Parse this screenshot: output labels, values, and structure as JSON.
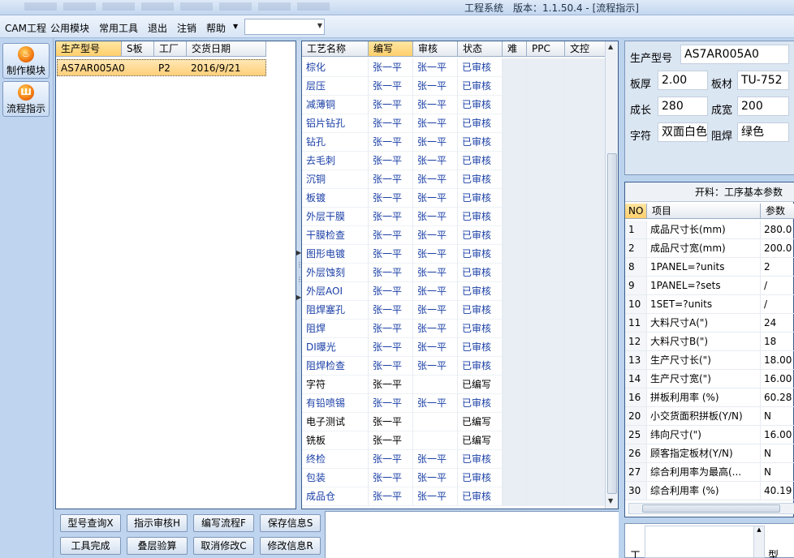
{
  "window": {
    "title": "工程系统　版本：1.1.50.4 - [流程指示]"
  },
  "menu": {
    "items": [
      "CAM工程",
      "公用模块",
      "常用工具",
      "退出",
      "注销",
      "帮助"
    ],
    "combo_value": ""
  },
  "nav": {
    "make_label": "制作模块",
    "flow_label": "流程指示"
  },
  "orders": {
    "headers": [
      "生产型号",
      "S板",
      "工厂",
      "交货日期"
    ],
    "rows": [
      {
        "model": "AS7AR005A0",
        "s": "",
        "factory": "P2",
        "date": "2016/9/21"
      }
    ]
  },
  "process": {
    "headers": [
      "工艺名称",
      "编写",
      "审核",
      "状态",
      "难",
      "PPC",
      "文控"
    ],
    "rows": [
      {
        "name": "棕化",
        "writer": "张一平",
        "reviewer": "张一平",
        "status": "已审核"
      },
      {
        "name": "层压",
        "writer": "张一平",
        "reviewer": "张一平",
        "status": "已审核"
      },
      {
        "name": "减薄铜",
        "writer": "张一平",
        "reviewer": "张一平",
        "status": "已审核"
      },
      {
        "name": "铝片钻孔",
        "writer": "张一平",
        "reviewer": "张一平",
        "status": "已审核"
      },
      {
        "name": "钻孔",
        "writer": "张一平",
        "reviewer": "张一平",
        "status": "已审核"
      },
      {
        "name": "去毛刺",
        "writer": "张一平",
        "reviewer": "张一平",
        "status": "已审核"
      },
      {
        "name": "沉铜",
        "writer": "张一平",
        "reviewer": "张一平",
        "status": "已审核"
      },
      {
        "name": "板镀",
        "writer": "张一平",
        "reviewer": "张一平",
        "status": "已审核"
      },
      {
        "name": "外层干膜",
        "writer": "张一平",
        "reviewer": "张一平",
        "status": "已审核"
      },
      {
        "name": "干膜检查",
        "writer": "张一平",
        "reviewer": "张一平",
        "status": "已审核"
      },
      {
        "name": "图形电镀",
        "writer": "张一平",
        "reviewer": "张一平",
        "status": "已审核"
      },
      {
        "name": "外层蚀刻",
        "writer": "张一平",
        "reviewer": "张一平",
        "status": "已审核"
      },
      {
        "name": "外层AOI",
        "writer": "张一平",
        "reviewer": "张一平",
        "status": "已审核"
      },
      {
        "name": "阻焊塞孔",
        "writer": "张一平",
        "reviewer": "张一平",
        "status": "已审核"
      },
      {
        "name": "阻焊",
        "writer": "张一平",
        "reviewer": "张一平",
        "status": "已审核"
      },
      {
        "name": "DI曝光",
        "writer": "张一平",
        "reviewer": "张一平",
        "status": "已审核"
      },
      {
        "name": "阻焊检查",
        "writer": "张一平",
        "reviewer": "张一平",
        "status": "已审核"
      },
      {
        "name": "字符",
        "writer": "张一平",
        "reviewer": "",
        "status": "已编写"
      },
      {
        "name": "有铅喷锡",
        "writer": "张一平",
        "reviewer": "张一平",
        "status": "已审核"
      },
      {
        "name": "电子测试",
        "writer": "张一平",
        "reviewer": "",
        "status": "已编写"
      },
      {
        "name": "铣板",
        "writer": "张一平",
        "reviewer": "",
        "status": "已编写"
      },
      {
        "name": "终检",
        "writer": "张一平",
        "reviewer": "张一平",
        "status": "已审核"
      },
      {
        "name": "包装",
        "writer": "张一平",
        "reviewer": "张一平",
        "status": "已审核"
      },
      {
        "name": "成品仓",
        "writer": "张一平",
        "reviewer": "张一平",
        "status": "已审核"
      }
    ]
  },
  "buttons": {
    "row1": [
      "型号查询X",
      "指示审核H",
      "编写流程F",
      "保存信息S"
    ],
    "row2": [
      "工具完成",
      "叠层验算",
      "取消修改C",
      "修改信息R"
    ]
  },
  "info": {
    "model_label": "生产型号",
    "model_value": "AS7AR005A0",
    "thickness_label": "板厚",
    "thickness_value": "2.00",
    "material_label": "板材",
    "material_value": "TU-752",
    "length_label": "成长",
    "length_value": "280",
    "width_label": "成宽",
    "width_value": "200",
    "char_label": "字符",
    "char_value": "双面白色",
    "mask_label": "阻焊",
    "mask_value": "绿色"
  },
  "params": {
    "caption": "开料：工序基本参数",
    "headers": [
      "NO",
      "项目",
      "参数"
    ],
    "rows": [
      {
        "no": "1",
        "item": "成品尺寸长(mm)",
        "value": "280.0"
      },
      {
        "no": "2",
        "item": "成品尺寸宽(mm)",
        "value": "200.0"
      },
      {
        "no": "8",
        "item": "1PANEL=?units",
        "value": "2"
      },
      {
        "no": "9",
        "item": "1PANEL=?sets",
        "value": "/"
      },
      {
        "no": "10",
        "item": "1SET=?units",
        "value": "/"
      },
      {
        "no": "11",
        "item": "大料尺寸A(\")",
        "value": "24"
      },
      {
        "no": "12",
        "item": "大料尺寸B(\")",
        "value": "18"
      },
      {
        "no": "13",
        "item": "生产尺寸长(\")",
        "value": "18.00"
      },
      {
        "no": "14",
        "item": "生产尺寸宽(\")",
        "value": "16.00"
      },
      {
        "no": "16",
        "item": "拼板利用率 (%)",
        "value": "60.28"
      },
      {
        "no": "20",
        "item": "小交货面积拼板(Y/N)",
        "value": "N"
      },
      {
        "no": "25",
        "item": "纬向尺寸(\")",
        "value": "16.00"
      },
      {
        "no": "26",
        "item": "顾客指定板材(Y/N)",
        "value": "N"
      },
      {
        "no": "27",
        "item": "综合利用率为最高(...",
        "value": "N"
      },
      {
        "no": "30",
        "item": "综合利用率 (%)",
        "value": "40.19"
      }
    ]
  },
  "bottom_right": {
    "label_left": "工",
    "label_right": "型"
  },
  "colors": {
    "link_blue": "#1a3fa6",
    "selected_row": "#ffcf7a",
    "header_highlight": "#ffd36b"
  }
}
